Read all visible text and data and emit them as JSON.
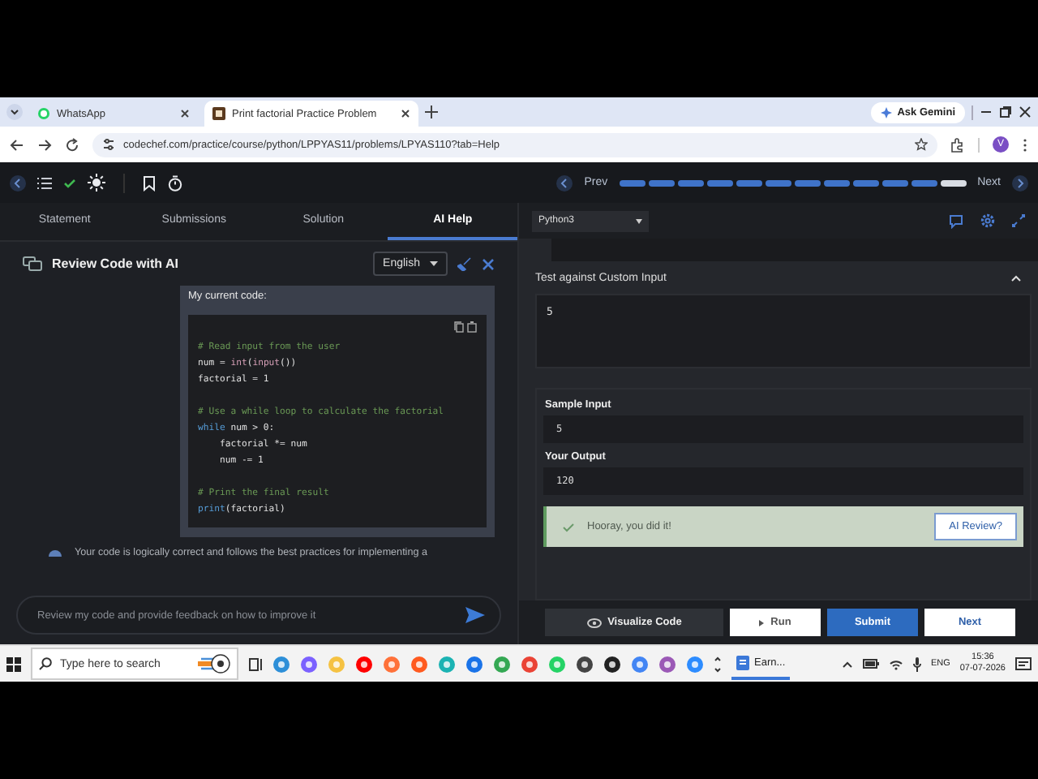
{
  "browser": {
    "tabs": [
      {
        "title": "WhatsApp",
        "selected": false
      },
      {
        "title": "Print factorial Practice Problem",
        "selected": true
      }
    ],
    "ask_gemini": "Ask Gemini",
    "url": "codechef.com/practice/course/python/LPPYAS11/problems/LPYAS110?tab=Help",
    "profile_initial": "V"
  },
  "toolbar": {
    "prev": "Prev",
    "next": "Next",
    "steps": [
      {
        "current": false
      },
      {
        "current": false
      },
      {
        "current": false
      },
      {
        "current": false
      },
      {
        "current": false
      },
      {
        "current": false
      },
      {
        "current": false
      },
      {
        "current": false
      },
      {
        "current": false
      },
      {
        "current": false
      },
      {
        "current": false
      },
      {
        "current": true
      }
    ]
  },
  "left": {
    "tabs": [
      {
        "label": "Statement",
        "selected": false
      },
      {
        "label": "Submissions",
        "selected": false
      },
      {
        "label": "Solution",
        "selected": false
      },
      {
        "label": "AI Help",
        "selected": true
      }
    ],
    "title": "Review Code with AI",
    "language": "English",
    "message_intro": "My current code:",
    "code": [
      {
        "kind": "code",
        "tokens": [
          {
            "text": "# Read input from the user",
            "kind": "comment"
          }
        ]
      },
      {
        "kind": "code",
        "tokens": [
          {
            "text": "num = ",
            "kind": "plain"
          },
          {
            "text": "int",
            "kind": "builtin"
          },
          {
            "text": "(",
            "kind": "plain"
          },
          {
            "text": "input",
            "kind": "builtin"
          },
          {
            "text": "())",
            "kind": "plain"
          }
        ]
      },
      {
        "kind": "code",
        "tokens": [
          {
            "text": "factorial = 1",
            "kind": "plain"
          }
        ]
      },
      {
        "kind": "blank"
      },
      {
        "kind": "code",
        "tokens": [
          {
            "text": "# Use a while loop to calculate the factorial",
            "kind": "comment"
          }
        ]
      },
      {
        "kind": "code",
        "tokens": [
          {
            "text": "while",
            "kind": "keyword"
          },
          {
            "text": " num > 0:",
            "kind": "plain"
          }
        ]
      },
      {
        "kind": "code",
        "tokens": [
          {
            "text": "    factorial *= num",
            "kind": "plain"
          }
        ]
      },
      {
        "kind": "code",
        "tokens": [
          {
            "text": "    num -= 1",
            "kind": "plain"
          }
        ]
      },
      {
        "kind": "blank"
      },
      {
        "kind": "code",
        "tokens": [
          {
            "text": "# Print the final result",
            "kind": "comment"
          }
        ]
      },
      {
        "kind": "code",
        "tokens": [
          {
            "text": "print",
            "kind": "keyword"
          },
          {
            "text": "(factorial)",
            "kind": "plain"
          }
        ]
      }
    ],
    "reply": "Your code is logically correct and follows the best practices for implementing a",
    "input": {
      "placeholder": "Review my code and provide feedback on how to improve it"
    }
  },
  "right": {
    "language": "Python3",
    "custom_input": {
      "title": "Test against Custom Input",
      "expanded": true,
      "value": "5"
    },
    "sample_input": {
      "label": "Sample Input",
      "value": "5"
    },
    "your_output": {
      "label": "Your Output",
      "value": "120"
    },
    "result": {
      "message": "Hooray, you did it!",
      "action": "AI Review?"
    },
    "buttons": [
      {
        "label": "Visualize Code",
        "kind": "visualize"
      },
      {
        "label": "Run",
        "kind": "run"
      },
      {
        "label": "Submit",
        "kind": "submit"
      },
      {
        "label": "Next",
        "kind": "next"
      }
    ]
  },
  "taskbar": {
    "search_placeholder": "Type here to search",
    "app_label": "Earn...",
    "language": "ENG",
    "time": "15:36",
    "date": "07-07-2026"
  }
}
